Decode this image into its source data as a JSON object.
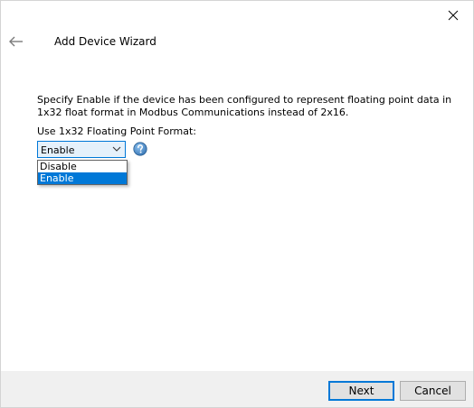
{
  "wizard": {
    "title": "Add Device Wizard",
    "description": "Specify Enable if the device has been configured to represent floating point data in 1x32 float format in Modbus Communications instead of 2x16.",
    "field_label": "Use 1x32 Floating Point Format:",
    "select": {
      "current_value": "Enable",
      "options": [
        {
          "label": "Disable",
          "selected": false
        },
        {
          "label": "Enable",
          "selected": true
        }
      ]
    }
  },
  "footer": {
    "next_label": "Next",
    "cancel_label": "Cancel"
  },
  "icons": {
    "close": "close-icon",
    "back": "back-arrow-icon",
    "help": "help-icon",
    "chevron": "chevron-down-icon"
  },
  "colors": {
    "accent": "#0078d7",
    "select_background": "#e5f1fb",
    "help_icon": "#3d7ab8",
    "footer_background": "#f0f0f0"
  }
}
